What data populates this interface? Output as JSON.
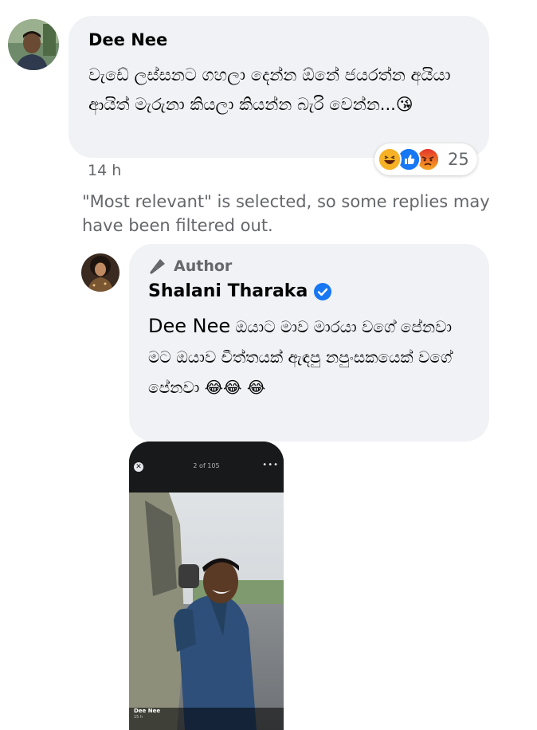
{
  "comment1": {
    "author": "Dee Nee",
    "text": "වැඩේ ලස්සනට ගහලා දෙන්න ඕනේ ජයරත්න අයියා ආයිත් මැරුනා කියලා කියන්න බැරි වෙන්න...😘",
    "time": "14 h",
    "reactions": {
      "icons": [
        "laugh-reaction",
        "like-reaction",
        "angry-reaction"
      ],
      "count": "25"
    }
  },
  "filter_note": "\"Most relevant\" is selected, so some replies may have been filtered out.",
  "reply": {
    "badge": "Author",
    "author": "Shalani Tharaka",
    "mention": "Dee Nee",
    "text": " ඔයාට මාව මාරයා වගේ පේනවා මට ඔයාව චීත්තයක් ඇඳපු නපුංසකයෙක් වගේ පේනවා 😂😂 😂"
  },
  "photo": {
    "counter": "2 of 105",
    "caption_name": "Dee Nee",
    "caption_time": "15 h"
  },
  "colors": {
    "bubble": "#f0f2f5",
    "secondary_text": "#65676b",
    "verified": "#1877f2"
  }
}
